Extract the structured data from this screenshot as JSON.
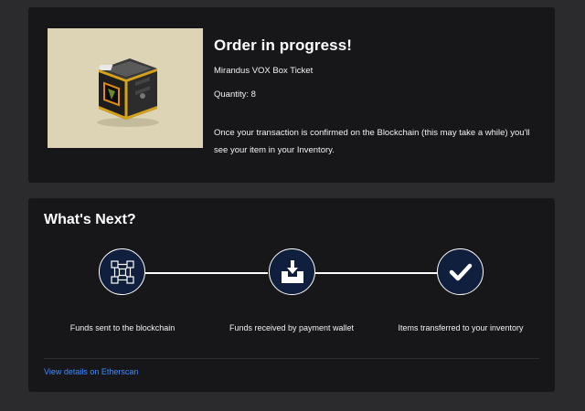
{
  "order": {
    "title": "Order in progress!",
    "product_name": "Mirandus VOX Box Ticket",
    "quantity": "Quantity: 8",
    "note": "Once your transaction is confirmed on the Blockchain (this may take a while) you'll see your item in your Inventory.",
    "image_icon": "vox-box-icon",
    "image_bg": "#ddd4b6"
  },
  "whats_next": {
    "title": "What's Next?",
    "steps": [
      {
        "icon": "blockchain-icon",
        "label": "Funds sent to the blockchain"
      },
      {
        "icon": "inbox-download-icon",
        "label": "Funds received by payment wallet"
      },
      {
        "icon": "checkmark-icon",
        "label": "Items transferred to your inventory"
      }
    ],
    "link_label": "View details on Etherscan"
  },
  "colors": {
    "background": "#2b2b2e",
    "card": "#17171a",
    "step_circle": "#0f1f3d",
    "link": "#3d8bff"
  }
}
